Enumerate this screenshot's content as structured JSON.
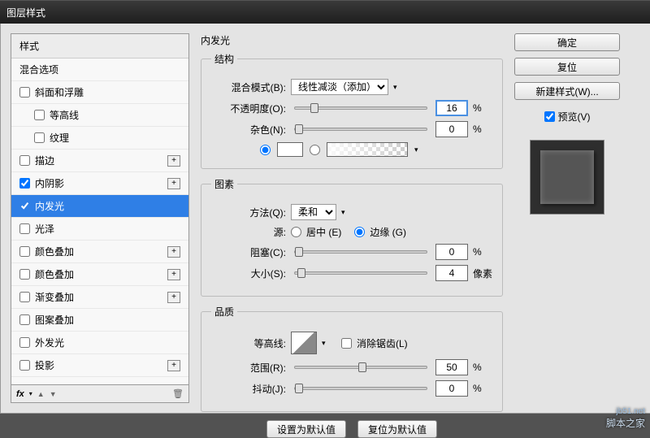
{
  "window": {
    "title": "图层样式"
  },
  "left": {
    "header": "样式",
    "blending": "混合选项",
    "items": [
      {
        "label": "斜面和浮雕",
        "checked": false,
        "plus": false,
        "indent": false
      },
      {
        "label": "等高线",
        "checked": false,
        "plus": false,
        "indent": true
      },
      {
        "label": "纹理",
        "checked": false,
        "plus": false,
        "indent": true
      },
      {
        "label": "描边",
        "checked": false,
        "plus": true,
        "indent": false
      },
      {
        "label": "内阴影",
        "checked": true,
        "plus": true,
        "indent": false
      },
      {
        "label": "内发光",
        "checked": true,
        "plus": false,
        "indent": false,
        "selected": true
      },
      {
        "label": "光泽",
        "checked": false,
        "plus": false,
        "indent": false
      },
      {
        "label": "颜色叠加",
        "checked": false,
        "plus": true,
        "indent": false
      },
      {
        "label": "颜色叠加",
        "checked": false,
        "plus": true,
        "indent": false
      },
      {
        "label": "渐变叠加",
        "checked": false,
        "plus": true,
        "indent": false
      },
      {
        "label": "图案叠加",
        "checked": false,
        "plus": false,
        "indent": false
      },
      {
        "label": "外发光",
        "checked": false,
        "plus": false,
        "indent": false
      },
      {
        "label": "投影",
        "checked": false,
        "plus": true,
        "indent": false
      }
    ],
    "fx": "fx"
  },
  "center": {
    "title": "内发光",
    "struct": {
      "legend": "结构",
      "blend_label": "混合模式(B):",
      "blend_value": "线性减淡（添加）",
      "opacity_label": "不透明度(O):",
      "opacity_value": "16",
      "opacity_unit": "%",
      "noise_label": "杂色(N):",
      "noise_value": "0",
      "noise_unit": "%"
    },
    "elements": {
      "legend": "图素",
      "method_label": "方法(Q):",
      "method_value": "柔和",
      "source_label": "源:",
      "source_center": "居中 (E)",
      "source_edge": "边缘 (G)",
      "choke_label": "阻塞(C):",
      "choke_value": "0",
      "choke_unit": "%",
      "size_label": "大小(S):",
      "size_value": "4",
      "size_unit": "像素"
    },
    "quality": {
      "legend": "品质",
      "contour_label": "等高线:",
      "antialias": "消除锯齿(L)",
      "range_label": "范围(R):",
      "range_value": "50",
      "range_unit": "%",
      "jitter_label": "抖动(J):",
      "jitter_value": "0",
      "jitter_unit": "%"
    },
    "buttons": {
      "default": "设置为默认值",
      "reset": "复位为默认值"
    }
  },
  "right": {
    "ok": "确定",
    "cancel": "复位",
    "new_style": "新建样式(W)...",
    "preview": "预览(V)"
  },
  "watermark": {
    "top": "jb51.net",
    "bottom": "脚本之家"
  }
}
